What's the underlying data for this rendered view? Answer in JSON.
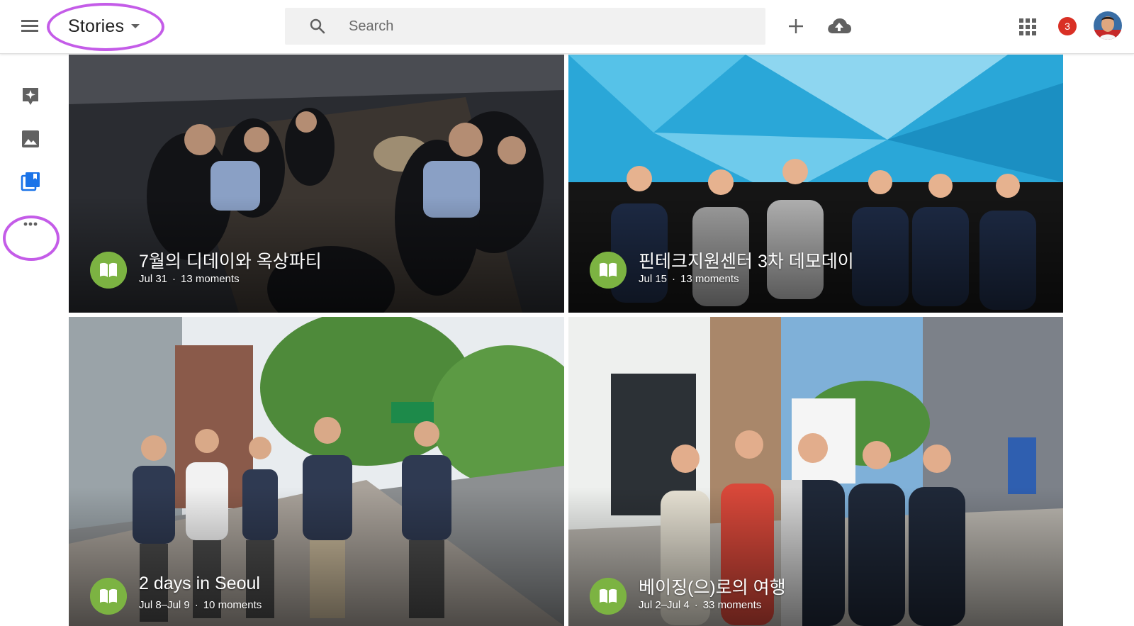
{
  "header": {
    "menu_icon": "hamburger-menu-icon",
    "title": "Stories",
    "search_placeholder": "Search",
    "add_icon": "plus-icon",
    "upload_icon": "cloud-upload-icon",
    "apps_icon": "apps-grid-icon",
    "notification_count": "3",
    "accent_color": "#c45ce8"
  },
  "rail": {
    "items": [
      {
        "name": "assistant",
        "icon": "assistant-sparkle-icon"
      },
      {
        "name": "photos",
        "icon": "image-icon"
      },
      {
        "name": "albums",
        "icon": "albums-icon",
        "selected": true
      },
      {
        "name": "more",
        "icon": "more-horiz-icon"
      }
    ],
    "selected_color": "#1a73e8"
  },
  "stories": [
    {
      "title": "7월의 디데이와 옥상파티",
      "date": "Jul 31",
      "moments": "13 moments"
    },
    {
      "title": "핀테크지원센터 3차 데모데이",
      "date": "Jul 15",
      "moments": "13 moments"
    },
    {
      "title": "2 days in Seoul",
      "date": "Jul 8–Jul 9",
      "moments": "10 moments"
    },
    {
      "title": "베이징(으)로의 여행",
      "date": "Jul 2–Jul 4",
      "moments": "33 moments"
    }
  ],
  "story_icon": "story-book-icon",
  "story_badge_color": "#7cb342"
}
